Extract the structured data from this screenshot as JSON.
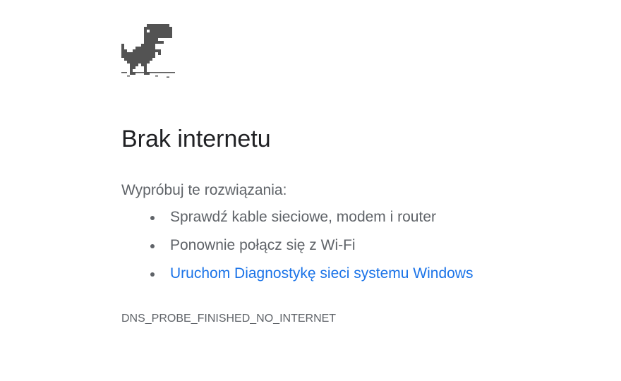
{
  "icon": {
    "name": "dino-offline-icon",
    "color": "#535353"
  },
  "title": "Brak internetu",
  "suggestions": {
    "heading": "Wypróbuj te rozwiązania:",
    "items": [
      {
        "text": "Sprawdź kable sieciowe, modem i router",
        "link": false
      },
      {
        "text": "Ponownie połącz się z Wi-Fi",
        "link": false
      },
      {
        "text": "Uruchom Diagnostykę sieci systemu Windows",
        "link": true
      }
    ]
  },
  "error_code": "DNS_PROBE_FINISHED_NO_INTERNET",
  "colors": {
    "title": "#202124",
    "body_text": "#5f6368",
    "link": "#1a73e8"
  }
}
